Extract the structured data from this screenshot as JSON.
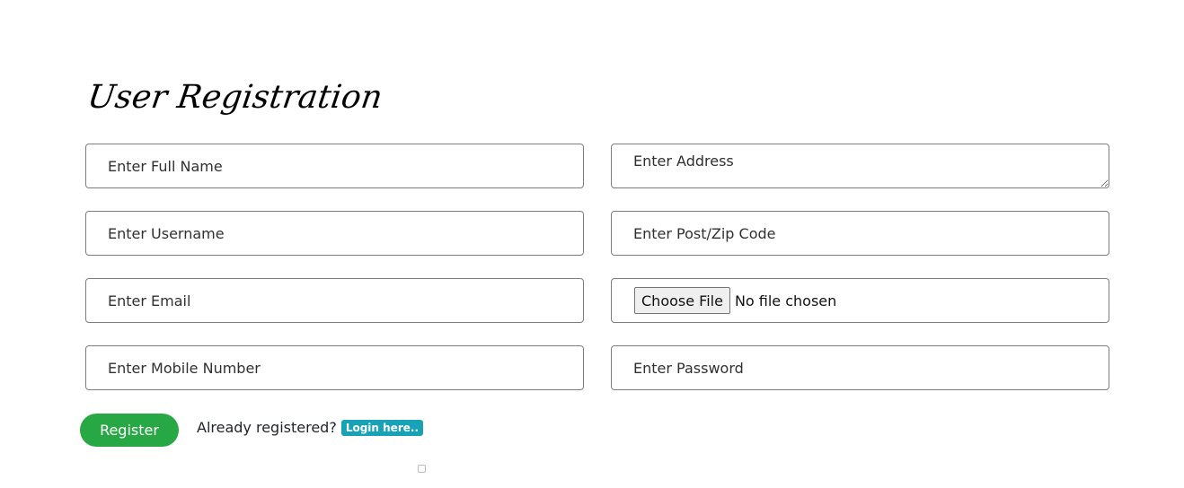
{
  "title": "User Registration",
  "form": {
    "full_name_placeholder": "Enter Full Name",
    "username_placeholder": "Enter Username",
    "email_placeholder": "Enter Email",
    "mobile_placeholder": "Enter Mobile Number",
    "address_placeholder": "Enter Address",
    "zip_placeholder": "Enter Post/Zip Code",
    "file_button_label": "Choose File",
    "file_status": "No file chosen",
    "password_placeholder": "Enter Password"
  },
  "actions": {
    "register_label": "Register",
    "already_registered_text": "Already registered?",
    "login_link_label": "Login here.."
  },
  "colors": {
    "register_green": "#28a745",
    "login_badge_teal": "#17a2b8"
  }
}
